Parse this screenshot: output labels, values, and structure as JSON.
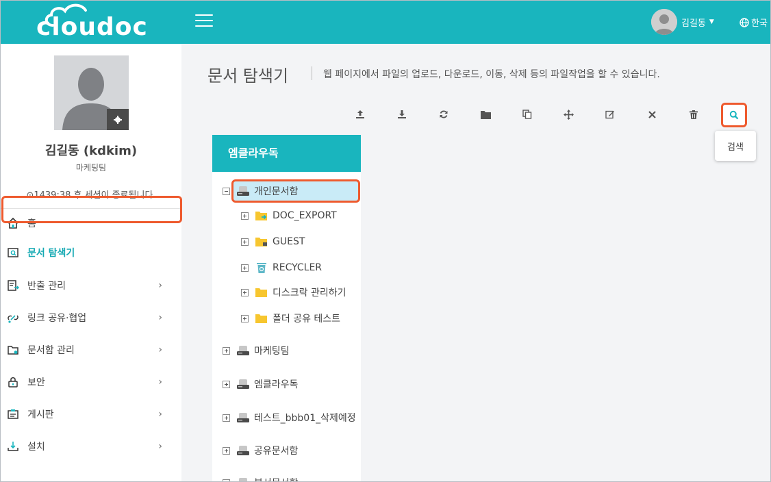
{
  "header": {
    "logo_text": "cloudoc",
    "user_name": "김길동",
    "language": "한국"
  },
  "sidebar": {
    "profile_name": "김길동 (kdkim)",
    "team": "마케팅팀",
    "session_text": "1439:38 후 세션이 종료됩니다.",
    "items": [
      {
        "label": "홈",
        "icon": "home-icon"
      },
      {
        "label": "문서 탐색기",
        "icon": "document-search-icon"
      },
      {
        "label": "반출 관리",
        "icon": "export-icon"
      },
      {
        "label": "링크 공유·협업",
        "icon": "link-share-icon"
      },
      {
        "label": "문서함 관리",
        "icon": "folder-settings-icon"
      },
      {
        "label": "보안",
        "icon": "lock-icon"
      },
      {
        "label": "게시판",
        "icon": "board-icon"
      },
      {
        "label": "설치",
        "icon": "download-install-icon"
      }
    ]
  },
  "main": {
    "title": "문서 탐색기",
    "description": "웹 페이지에서 파일의 업로드, 다운로드, 이동, 삭제 등의 파일작업을 할 수 있습니다.",
    "toolbar": [
      "upload-icon",
      "download-icon",
      "refresh-icon",
      "folder-icon",
      "copy-icon",
      "move-icon",
      "edit-icon",
      "close-icon",
      "trash-icon",
      "search-icon"
    ],
    "search_tooltip": "검색"
  },
  "tree": {
    "header": "엠클라우독",
    "personal": "개인문서함",
    "children": [
      "DOC_EXPORT",
      "GUEST",
      "RECYCLER",
      "디스크락 관리하기",
      "폴더 공유 테스트"
    ],
    "roots": [
      "마케팅팀",
      "엠클라우독",
      "테스트_bbb01_삭제예정",
      "공유문서함",
      "부서문서함"
    ]
  },
  "colors": {
    "accent": "#19b5be",
    "highlight": "#ee5a2e",
    "selection": "#c9ebf7"
  }
}
